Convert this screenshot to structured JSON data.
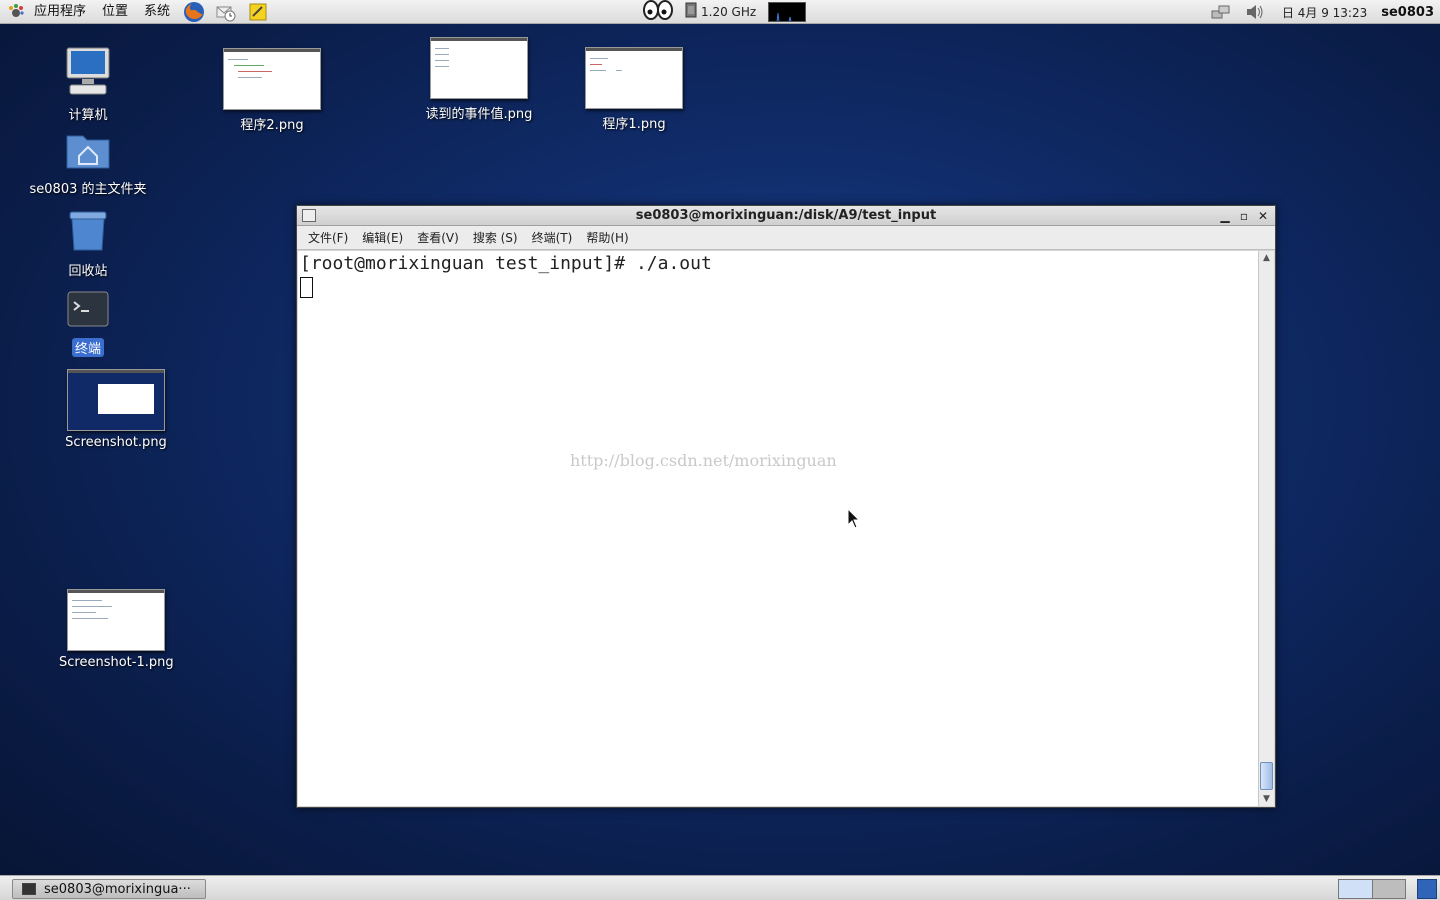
{
  "top_panel": {
    "menus": [
      "应用程序",
      "位置",
      "系统"
    ],
    "cpu_freq": "1.20 GHz",
    "clock": "日 4月  9 13:23",
    "user": "se0803"
  },
  "desktop_icons": {
    "computer": "计算机",
    "home": "se0803 的主文件夹",
    "trash": "回收站",
    "terminal": "终端",
    "screenshot": "Screenshot.png",
    "screenshot1": "Screenshot-1.png",
    "program2": "程序2.png",
    "events": "读到的事件值.png",
    "program1": "程序1.png"
  },
  "terminal": {
    "title": "se0803@morixinguan:/disk/A9/test_input",
    "menus": [
      "文件(F)",
      "编辑(E)",
      "查看(V)",
      "搜索 (S)",
      "终端(T)",
      "帮助(H)"
    ],
    "prompt": "[root@morixinguan test_input]# ./a.out",
    "watermark": "http://blog.csdn.net/morixinguan"
  },
  "bottom_panel": {
    "task_label": "se0803@morixingua···"
  },
  "colors": {
    "desktop_bg": "#0f2a66",
    "selection": "#3a6ecf",
    "watermark": "#c9c9c9"
  }
}
